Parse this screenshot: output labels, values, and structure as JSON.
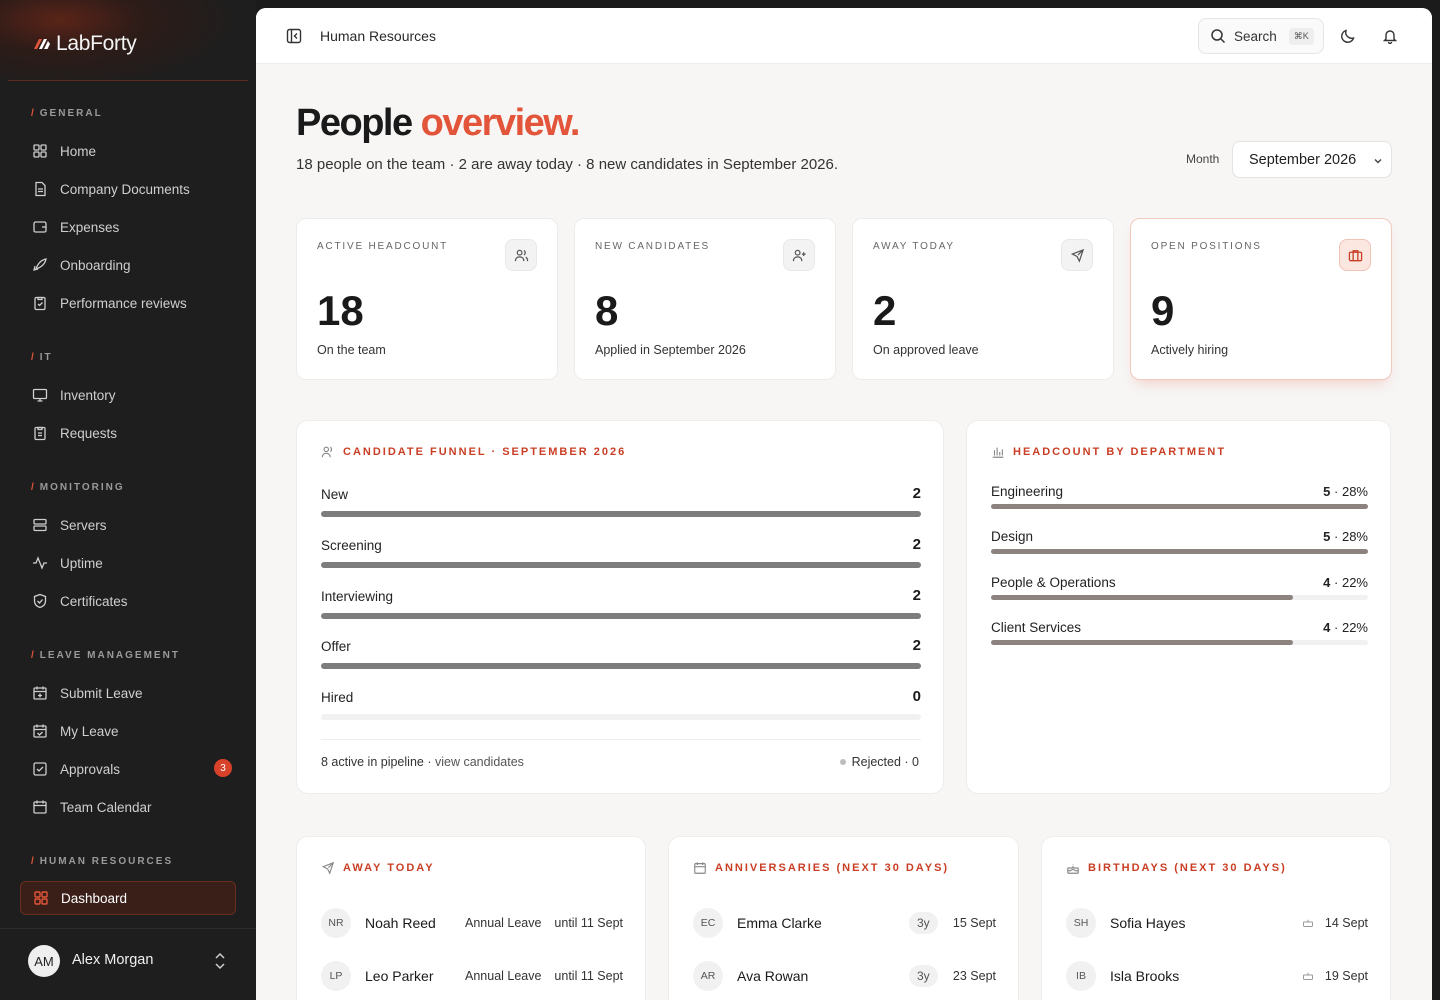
{
  "brand": {
    "name": "LabForty"
  },
  "sidebar": {
    "sections": [
      {
        "label": "GENERAL",
        "items": [
          "Home",
          "Company Documents",
          "Expenses",
          "Onboarding",
          "Performance reviews"
        ]
      },
      {
        "label": "IT",
        "items": [
          "Inventory",
          "Requests"
        ]
      },
      {
        "label": "MONITORING",
        "items": [
          "Servers",
          "Uptime",
          "Certificates"
        ]
      },
      {
        "label": "LEAVE MANAGEMENT",
        "items": [
          "Submit Leave",
          "My Leave",
          "Approvals",
          "Team Calendar"
        ]
      },
      {
        "label": "HUMAN RESOURCES",
        "items": [
          "Dashboard"
        ]
      }
    ],
    "approvals_badge": "3",
    "active_item": "Dashboard",
    "user": {
      "initials": "AM",
      "name": "Alex Morgan"
    }
  },
  "topbar": {
    "breadcrumb": "Human Resources",
    "search_label": "Search",
    "search_shortcut": "⌘K"
  },
  "header": {
    "title_main": "People",
    "title_accent": "overview.",
    "subtitle": "18 people on the team · 2 are away today · 8 new candidates in September 2026.",
    "month_label": "Month",
    "month_value": "September 2026"
  },
  "stats": [
    {
      "label": "ACTIVE HEADCOUNT",
      "value": "18",
      "caption": "On the team",
      "icon": "users-icon"
    },
    {
      "label": "NEW CANDIDATES",
      "value": "8",
      "caption": "Applied in September 2026",
      "icon": "user-plus-icon"
    },
    {
      "label": "AWAY TODAY",
      "value": "2",
      "caption": "On approved leave",
      "icon": "plane-icon"
    },
    {
      "label": "OPEN POSITIONS",
      "value": "9",
      "caption": "Actively hiring",
      "icon": "briefcase-icon"
    }
  ],
  "funnel": {
    "title": "CANDIDATE FUNNEL · SEPTEMBER 2026",
    "stages": [
      {
        "label": "New",
        "count": "2",
        "fraction": 1
      },
      {
        "label": "Screening",
        "count": "2",
        "fraction": 1
      },
      {
        "label": "Interviewing",
        "count": "2",
        "fraction": 1
      },
      {
        "label": "Offer",
        "count": "2",
        "fraction": 1
      },
      {
        "label": "Hired",
        "count": "0",
        "fraction": 0
      }
    ],
    "footer_active": "8 active in pipeline",
    "footer_link": "view candidates",
    "rejected": "Rejected · 0"
  },
  "departments": {
    "title": "HEADCOUNT BY DEPARTMENT",
    "items": [
      {
        "label": "Engineering",
        "count": "5",
        "pct": "28%",
        "fraction": 1
      },
      {
        "label": "Design",
        "count": "5",
        "pct": "28%",
        "fraction": 1
      },
      {
        "label": "People & Operations",
        "count": "4",
        "pct": "22%",
        "fraction": 0.8
      },
      {
        "label": "Client Services",
        "count": "4",
        "pct": "22%",
        "fraction": 0.8
      }
    ]
  },
  "away": {
    "title": "AWAY TODAY",
    "rows": [
      {
        "initials": "NR",
        "name": "Noah Reed",
        "type": "Annual Leave",
        "until": "until 11 Sept"
      },
      {
        "initials": "LP",
        "name": "Leo Parker",
        "type": "Annual Leave",
        "until": "until 11 Sept"
      }
    ]
  },
  "anniversaries": {
    "title": "ANNIVERSARIES (NEXT 30 DAYS)",
    "rows": [
      {
        "initials": "EC",
        "name": "Emma Clarke",
        "years": "3y",
        "date": "15 Sept"
      },
      {
        "initials": "AR",
        "name": "Ava Rowan",
        "years": "3y",
        "date": "23 Sept"
      }
    ]
  },
  "birthdays": {
    "title": "BIRTHDAYS (NEXT 30 DAYS)",
    "rows": [
      {
        "initials": "SH",
        "name": "Sofia Hayes",
        "date": "14 Sept"
      },
      {
        "initials": "IB",
        "name": "Isla Brooks",
        "date": "19 Sept"
      }
    ]
  },
  "colors": {
    "accent": "#e2553a",
    "accent_dark": "#c93e24",
    "sidebar_bg": "#1e1e1e"
  }
}
